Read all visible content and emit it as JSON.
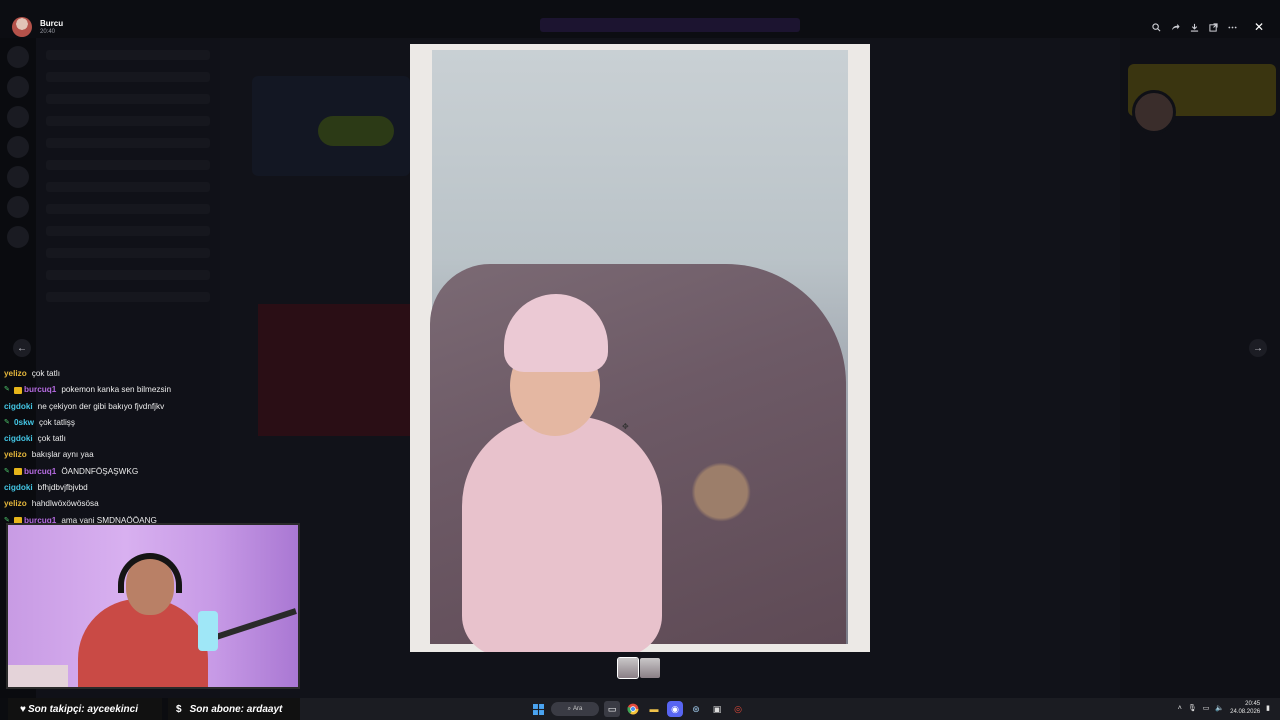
{
  "viewer": {
    "user_name": "Burcu",
    "user_time": "20:40",
    "tools": [
      "zoom-icon",
      "share-icon",
      "download-icon",
      "open-external-icon",
      "more-icon"
    ],
    "close_glyph": "✕",
    "prev_glyph": "←",
    "next_glyph": "→"
  },
  "chat": {
    "messages": [
      {
        "user": "yelizo",
        "color": "#e3b53b",
        "message": "çok tatlı",
        "badges": []
      },
      {
        "user": "burcuq1",
        "color": "#b56be0",
        "message": "pokemon kanka sen bilmezsin",
        "badges": [
          "mod",
          "sub"
        ]
      },
      {
        "user": "cigdoki",
        "color": "#43c5e3",
        "message": "ne çekiyon der gibi bakıyo fjvdnfjkv",
        "badges": []
      },
      {
        "user": "0skw",
        "color": "#43c5e3",
        "message": "çok tatlişş",
        "badges": [
          "mod"
        ]
      },
      {
        "user": "cigdoki",
        "color": "#43c5e3",
        "message": "çok tatlı",
        "badges": []
      },
      {
        "user": "yelizo",
        "color": "#e3b53b",
        "message": "bakışlar aynı yaa",
        "badges": []
      },
      {
        "user": "burcuq1",
        "color": "#b56be0",
        "message": "ÖANDNFÖŞAŞWKG",
        "badges": [
          "mod",
          "sub"
        ]
      },
      {
        "user": "cigdoki",
        "color": "#43c5e3",
        "message": "bfhjdbvjfbjvbd",
        "badges": []
      },
      {
        "user": "yelizo",
        "color": "#e3b53b",
        "message": "hahdlwöxöwösösa",
        "badges": []
      },
      {
        "user": "burcuq1",
        "color": "#b56be0",
        "message": "ama yani SMDNAÖÖANG",
        "badges": [
          "mod",
          "sub"
        ]
      }
    ]
  },
  "footer": {
    "follower_label": "Son takipçi: ayceekinci",
    "subscriber_label": "Son abone: ardaayt"
  },
  "taskbar": {
    "search_label": "Ara",
    "time": "20:45",
    "date": "24.08.2026"
  },
  "colors": {
    "mod_badge": "#4dc36a",
    "sub_badge": "#e6b51a"
  }
}
